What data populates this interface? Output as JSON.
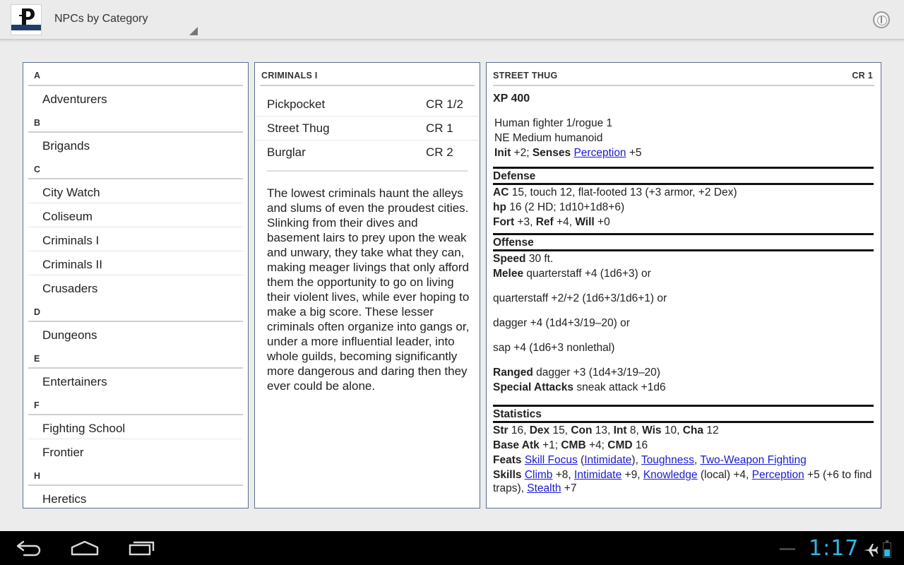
{
  "app": {
    "title": "NPCs by Category"
  },
  "categories": [
    {
      "letter": "A",
      "items": [
        "Adventurers"
      ]
    },
    {
      "letter": "B",
      "items": [
        "Brigands"
      ]
    },
    {
      "letter": "C",
      "items": [
        "City Watch",
        "Coliseum",
        "Criminals I",
        "Criminals II",
        "Crusaders"
      ]
    },
    {
      "letter": "D",
      "items": [
        "Dungeons"
      ]
    },
    {
      "letter": "E",
      "items": [
        "Entertainers"
      ]
    },
    {
      "letter": "F",
      "items": [
        "Fighting School",
        "Frontier"
      ]
    },
    {
      "letter": "H",
      "items": [
        "Heretics"
      ]
    }
  ],
  "category_panel": {
    "heading": "CRIMINALS I",
    "npcs": [
      {
        "name": "Pickpocket",
        "cr": "CR 1/2"
      },
      {
        "name": "Street Thug",
        "cr": "CR 1"
      },
      {
        "name": "Burglar",
        "cr": "CR 2"
      }
    ],
    "description": "The lowest criminals haunt the alleys and slums of even the proudest cities. Slinking from their dives and basement lairs to prey upon the weak and unwary, they take what they can, making meager livings that only afford them the opportunity to go on living their violent lives, while ever hoping to make a big score. These lesser criminals often organize into gangs or, under a more influential leader, into whole guilds, becoming significantly more dangerous and daring then they ever could be alone."
  },
  "statblock": {
    "name": "STREET THUG",
    "cr": "CR 1",
    "xp": "XP 400",
    "class_line": "Human fighter 1/rogue 1",
    "type_line": "NE Medium humanoid",
    "init_label": "Init",
    "init_value": " +2; ",
    "senses_label": "Senses",
    "senses_link": "Perception",
    "senses_value": " +5",
    "defense_title": "Defense",
    "ac_label": "AC",
    "ac_value": " 15, touch 12, flat-footed 13 (+3 armor, +2 Dex)",
    "hp_label": "hp",
    "hp_value": " 16 (2 HD; 1d10+1d8+6)",
    "fort_label": "Fort",
    "fort_value": " +3, ",
    "ref_label": "Ref",
    "ref_value": " +4, ",
    "will_label": "Will",
    "will_value": " +0",
    "offense_title": "Offense",
    "speed_label": "Speed",
    "speed_value": " 30 ft.",
    "melee_label": "Melee",
    "melee_value": " quarterstaff +4 (1d6+3) or",
    "melee_alt1": "quarterstaff +2/+2 (1d6+3/1d6+1) or",
    "melee_alt2": "dagger +4 (1d4+3/19–20) or",
    "melee_alt3": "sap +4 (1d6+3 nonlethal)",
    "ranged_label": "Ranged",
    "ranged_value": " dagger +3 (1d4+3/19–20)",
    "special_label": "Special Attacks",
    "special_value": " sneak attack +1d6",
    "statistics_title": "Statistics",
    "str_label": "Str",
    "str_value": " 16, ",
    "dex_label": "Dex",
    "dex_value": " 15, ",
    "con_label": "Con",
    "con_value": " 13, ",
    "int_label": "Int",
    "int_value": " 8, ",
    "wis_label": "Wis",
    "wis_value": " 10, ",
    "cha_label": "Cha",
    "cha_value": " 12",
    "bab_label": "Base Atk",
    "bab_value": " +1; ",
    "cmb_label": "CMB",
    "cmb_value": " +4; ",
    "cmd_label": "CMD",
    "cmd_value": " 16",
    "feats_label": "Feats",
    "feat1": "Skill Focus",
    "feat1_open": " (",
    "feat1_sub": "Intimidate",
    "feat1_close": "), ",
    "feat2": "Toughness",
    "feat_sep": ", ",
    "feat3": "Two-Weapon Fighting",
    "skills_label": "Skills",
    "skill1": "Climb",
    "skill1_val": " +8, ",
    "skill2": "Intimidate",
    "skill2_val": " +9, ",
    "skill3": "Knowledge",
    "skill3_val": " (local) +4, ",
    "skill4": "Perception",
    "skill4_val": " +5 (+6 to find traps), ",
    "skill5": "Stealth",
    "skill5_val": " +7"
  },
  "system": {
    "clock": "1:17",
    "battery_level": 0.55
  },
  "icons": {
    "app_logo": "paizo-logo-icon",
    "info": "info-icon",
    "back": "back-icon",
    "home": "home-icon",
    "recents": "recent-apps-icon",
    "airplane": "airplane-mode-icon",
    "battery": "battery-icon"
  },
  "colors": {
    "link": "#1a1ad6",
    "clock": "#33b5e5",
    "panel_border": "#5a6f8f"
  }
}
